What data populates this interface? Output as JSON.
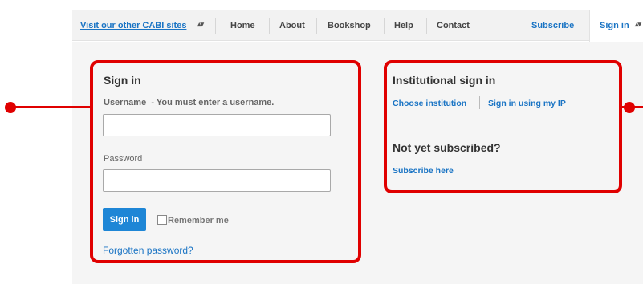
{
  "nav": {
    "cabi_sites": "Visit our other CABI sites",
    "home": "Home",
    "about": "About",
    "bookshop": "Bookshop",
    "help": "Help",
    "contact": "Contact",
    "subscribe": "Subscribe",
    "signin": "Sign in"
  },
  "signin": {
    "title": "Sign in",
    "username_label": "Username",
    "username_error": "- You must enter a username.",
    "username_value": "",
    "password_label": "Password",
    "password_value": "",
    "button": "Sign in",
    "remember": "Remember me",
    "forgot": "Forgotten password?"
  },
  "institutional": {
    "title": "Institutional sign in",
    "choose": "Choose institution",
    "ip": "Sign in using my IP"
  },
  "subscribe_section": {
    "title": "Not yet subscribed?",
    "link": "Subscribe here"
  },
  "colors": {
    "annotation": "#e00000",
    "link": "#1a74c4",
    "button": "#1e86d6"
  }
}
